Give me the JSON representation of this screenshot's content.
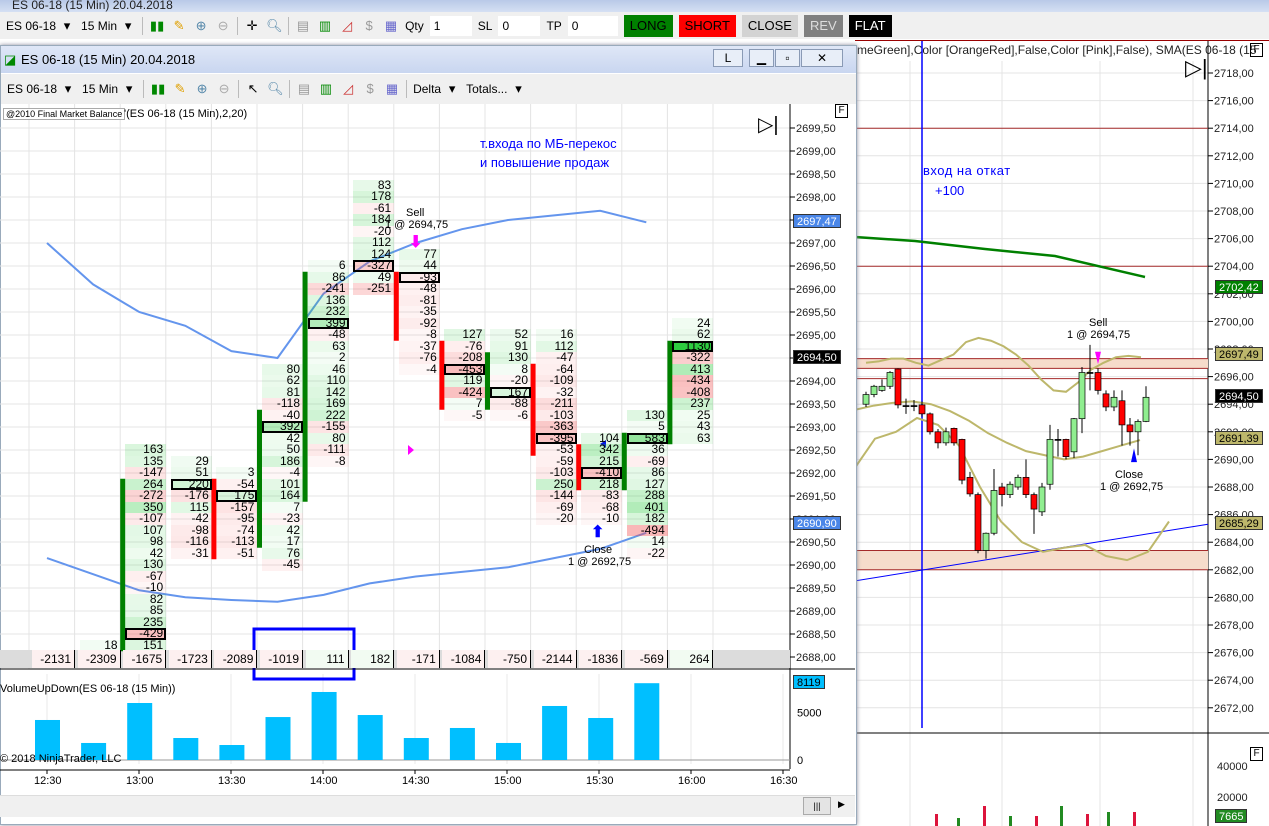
{
  "background_window": {
    "title": "ES 06-18 (15 Min)  20.04.2018"
  },
  "outer_toolbar": {
    "instrument": "ES 06-18",
    "interval": "15 Min",
    "qty_label": "Qty",
    "qty_value": "1",
    "sl_label": "SL",
    "sl_value": "0",
    "tp_label": "TP",
    "tp_value": "0",
    "long": "LONG",
    "short": "SHORT",
    "close": "CLOSE",
    "rev": "REV",
    "flat": "FLAT"
  },
  "colors": {
    "long": "#008000",
    "short": "#ff0000",
    "close": "#d3d3d3",
    "rev": "#808080",
    "flat": "#000000",
    "buy_cell": "#2ecc40",
    "sell_cell": "#f08080",
    "sma": "#6495ed",
    "volume": "#00bfff",
    "bollinger": "#bdb76b",
    "sma_right": "#008000",
    "level": "#a52a2a"
  },
  "inner_window": {
    "title": "ES 06-18 (15 Min)  20.04.2018",
    "layout_button": "L",
    "toolbar": {
      "instrument": "ES 06-18",
      "interval": "15 Min",
      "mode": "Delta",
      "totals": "Totals..."
    },
    "indicator_label": "@2010 Final Market Balance",
    "indicator_params": "'(ES 06-18 (15 Min),2,20)",
    "f_label": "F",
    "annotation_line1": "т.входа  по МБ-перекос",
    "annotation_line2": "и повышение продаж",
    "sell_label": "Sell",
    "sell_detail": "1 @ 2694,75",
    "close_label": "Close",
    "close_detail": "1 @ 2692,75",
    "price_ticks": [
      "2699,50",
      "2699,00",
      "2698,50",
      "2698,00",
      "2697,50",
      "2697,00",
      "2696,50",
      "2696,00",
      "2695,50",
      "2695,00",
      "2694,50",
      "2694,00",
      "2693,50",
      "2693,00",
      "2692,50",
      "2692,00",
      "2691,50",
      "2691,00",
      "2690,50",
      "2690,00",
      "2689,50",
      "2689,00",
      "2688,50",
      "2688,00"
    ],
    "badges": {
      "upper_band": "2697,47",
      "last_price": "2694,50",
      "lower_band": "2690,90",
      "volume": "8119"
    },
    "volume_label": "VolumeUpDown(ES 06-18 (15 Min))",
    "copyright": "© 2018 NinjaTrader, LLC",
    "volume_ticks": [
      "5000",
      "0"
    ],
    "time_ticks": [
      "12:30",
      "13:00",
      "13:30",
      "14:00",
      "14:30",
      "15:00",
      "15:30",
      "16:00",
      "16:30"
    ]
  },
  "chart_data": [
    {
      "type": "footprint",
      "columns": [
        {
          "total": "-2131",
          "top": null,
          "cells": [],
          "boxed": null,
          "candle": null
        },
        {
          "total": "-2309",
          "top": 2688.25,
          "cells": [
            18
          ],
          "boxed": null,
          "candle": null
        },
        {
          "total": "-1675",
          "top": 2692.5,
          "cells": [
            163,
            135,
            -147,
            264,
            -272,
            350,
            -107,
            107,
            98,
            42,
            130,
            -67,
            -10,
            82,
            85,
            235,
            -429,
            151
          ],
          "boxed": 16,
          "candle": {
            "open": 2688.25,
            "close": 2691.75
          }
        },
        {
          "total": "-1723",
          "top": 2692.25,
          "cells": [
            29,
            51,
            220,
            -176,
            115,
            -42,
            -98,
            -116,
            -31
          ],
          "boxed": 2,
          "candle": null
        },
        {
          "total": "-2089",
          "top": 2692.0,
          "cells": [
            3,
            -54,
            175,
            -157,
            -95,
            -74,
            -113,
            -51
          ],
          "boxed": 2,
          "candle": {
            "open": 2691.75,
            "close": 2690.25
          }
        },
        {
          "total": "-1019",
          "top": 2694.25,
          "cells": [
            80,
            62,
            81,
            -118,
            -40,
            392,
            42,
            50,
            186,
            -4,
            101,
            164,
            7,
            -23,
            42,
            17,
            76,
            -45
          ],
          "boxed": 5,
          "candle": {
            "open": 2690.5,
            "close": 2693.25
          }
        },
        {
          "total": "111",
          "top": 2696.5,
          "cells": [
            6,
            86,
            -241,
            136,
            232,
            399,
            -48,
            63,
            2,
            46,
            110,
            142,
            169,
            222,
            -155,
            80,
            -111,
            -8
          ],
          "boxed": 5,
          "candle": {
            "open": 2691.5,
            "close": 2696.25
          }
        },
        {
          "total": "182",
          "top": 2698.25,
          "cells": [
            83,
            178,
            -61,
            184,
            -20,
            112,
            124,
            -327,
            49,
            -251
          ],
          "boxed": 7,
          "candle": null
        },
        {
          "total": "-171",
          "top": 2696.75,
          "cells": [
            77,
            44,
            -93,
            -48,
            -81,
            -35,
            -92,
            -8,
            -37,
            -76,
            -4
          ],
          "boxed": 2,
          "candle": {
            "open": 2696.25,
            "close": 2695.0
          }
        },
        {
          "total": "-1084",
          "top": 2695.0,
          "cells": [
            127,
            -76,
            -208,
            -453,
            119,
            -424,
            7,
            -5
          ],
          "boxed": 3,
          "candle": {
            "open": 2694.75,
            "close": 2693.5
          }
        },
        {
          "total": "-750",
          "top": 2695.0,
          "cells": [
            52,
            91,
            130,
            8,
            -20,
            167,
            -88,
            -6
          ],
          "boxed": 5,
          "candle": {
            "open": 2693.5,
            "close": 2694.5
          }
        },
        {
          "total": "-2144",
          "top": 2695.0,
          "cells": [
            16,
            112,
            -47,
            -64,
            -109,
            -32,
            -211,
            -103,
            -363,
            -395,
            -53,
            -59,
            -103,
            250,
            -144,
            -69,
            -20
          ],
          "boxed": 9,
          "candle": {
            "open": 2694.25,
            "close": 2692.5
          }
        },
        {
          "total": "-1836",
          "top": 2692.75,
          "cells": [
            104,
            342,
            215,
            -410,
            218,
            -83,
            -68,
            -10
          ],
          "boxed": 3,
          "candle": {
            "open": 2692.5,
            "close": 2691.75
          }
        },
        {
          "total": "-569",
          "top": 2693.25,
          "cells": [
            130,
            5,
            583,
            36,
            -69,
            86,
            127,
            288,
            401,
            182,
            -494,
            14,
            -22
          ],
          "boxed": 2,
          "candle": {
            "open": 2691.75,
            "close": 2692.75
          }
        },
        {
          "total": "264",
          "top": 2695.25,
          "cells": [
            24,
            62,
            1130,
            -322,
            413,
            -434,
            -408,
            237,
            25,
            43,
            63
          ],
          "boxed": 2,
          "candle": {
            "open": 2692.75,
            "close": 2694.75
          }
        }
      ],
      "upper_band": [
        2697.0,
        2696.1,
        2695.5,
        2695.2,
        2694.65,
        2694.5,
        2695.9,
        2696.6,
        2697.0,
        2697.3,
        2697.5,
        2697.6,
        2697.7,
        2697.45
      ],
      "lower_band": [
        2690.15,
        2689.8,
        2689.45,
        2689.3,
        2689.24,
        2689.2,
        2689.35,
        2689.6,
        2689.75,
        2689.85,
        2689.95,
        2690.15,
        2690.35,
        2690.7
      ],
      "ylim": [
        2688.0,
        2699.5
      ]
    },
    {
      "type": "bar",
      "categories": [
        "12:30",
        "12:45",
        "13:00",
        "13:15",
        "13:30",
        "13:45",
        "14:00",
        "14:15",
        "14:30",
        "14:45",
        "15:00",
        "15:15",
        "15:30",
        "15:45"
      ],
      "values": [
        4230,
        1800,
        6025,
        2325,
        1585,
        4540,
        7190,
        4755,
        2325,
        3385,
        1800,
        5710,
        4440,
        8119
      ],
      "ylim": [
        0,
        9000
      ]
    },
    {
      "type": "candlestick",
      "candles": [
        [
          2694.0,
          2694.9,
          2693.8,
          2694.7
        ],
        [
          2694.7,
          2695.4,
          2694.5,
          2695.3
        ],
        [
          2695.0,
          2695.8,
          2694.9,
          2695.3
        ],
        [
          2695.3,
          2696.4,
          2695.1,
          2696.3
        ],
        [
          2696.55,
          2696.6,
          2693.7,
          2693.95
        ],
        [
          2693.9,
          2694.4,
          2693.3,
          2693.9
        ],
        [
          2693.9,
          2694.3,
          2693.5,
          2693.9
        ],
        [
          2693.95,
          2694.2,
          2693.1,
          2693.3
        ],
        [
          2693.3,
          2693.4,
          2691.8,
          2692.0
        ],
        [
          2692.0,
          2692.2,
          2690.8,
          2691.2
        ],
        [
          2691.2,
          2692.3,
          2691.0,
          2692.0
        ],
        [
          2692.25,
          2692.3,
          2691.0,
          2691.2
        ],
        [
          2691.45,
          2691.5,
          2688.2,
          2688.5
        ],
        [
          2688.7,
          2689.1,
          2687.3,
          2687.5
        ],
        [
          2687.45,
          2687.6,
          2683.2,
          2683.4
        ],
        [
          2683.4,
          2684.7,
          2682.8,
          2684.65
        ],
        [
          2684.65,
          2689.3,
          2684.5,
          2687.75
        ],
        [
          2688.0,
          2688.3,
          2686.6,
          2687.45
        ],
        [
          2687.45,
          2688.4,
          2687.2,
          2688.2
        ],
        [
          2688.0,
          2688.9,
          2687.8,
          2688.7
        ],
        [
          2688.7,
          2690.0,
          2687.2,
          2687.45
        ],
        [
          2687.45,
          2687.6,
          2684.6,
          2686.4
        ],
        [
          2686.2,
          2688.3,
          2685.9,
          2688.0
        ],
        [
          2688.2,
          2692.5,
          2687.8,
          2691.45
        ],
        [
          2691.45,
          2692.2,
          2690.2,
          2691.45
        ],
        [
          2691.45,
          2691.5,
          2690.0,
          2690.2
        ],
        [
          2690.55,
          2693.0,
          2690.1,
          2692.95
        ],
        [
          2692.95,
          2696.7,
          2691.9,
          2696.3
        ],
        [
          2696.3,
          2698.3,
          2695.0,
          2696.3
        ],
        [
          2696.3,
          2696.6,
          2694.7,
          2695.0
        ],
        [
          2694.75,
          2695.0,
          2693.5,
          2693.8
        ],
        [
          2693.8,
          2695.0,
          2693.5,
          2694.5
        ],
        [
          2694.25,
          2695.0,
          2691.0,
          2692.5
        ],
        [
          2692.5,
          2693.0,
          2691.0,
          2692.0
        ],
        [
          2692.0,
          2692.9,
          2690.3,
          2692.75
        ],
        [
          2692.75,
          2695.3,
          2692.7,
          2694.5
        ]
      ],
      "price_ticks": [
        "2718,00",
        "2716,00",
        "2714,00",
        "2712,00",
        "2710,00",
        "2708,00",
        "2706,00",
        "2704,00",
        "2702,00",
        "2700,00",
        "2698,00",
        "2696,00",
        "2694,00",
        "2692,00",
        "2690,00",
        "2688,00",
        "2686,00",
        "2684,00",
        "2682,00",
        "2680,00",
        "2678,00",
        "2676,00",
        "2674,00",
        "2672,00"
      ],
      "ylim": [
        2670.0,
        2719.5
      ]
    }
  ],
  "outer_chart": {
    "indicator_text": "meGreen],Color [OrangeRed],False,Color [Pink],False), SMA(ES 06-18 (15",
    "annotation_line1": "вход на откат",
    "annotation_line2": "+100",
    "sell_label": "Sell",
    "sell_detail": "1 @ 2694,75",
    "close_label": "Close",
    "close_detail": "1 @ 2692,75",
    "badges": {
      "sma": "2702,42",
      "upper_band": "2697,49",
      "last_price": "2694,50",
      "lower_band": "2691,39",
      "trendline": "2685,29",
      "volume": "7665"
    },
    "volume_ticks": [
      "40000",
      "20000"
    ],
    "f_label": "F"
  }
}
